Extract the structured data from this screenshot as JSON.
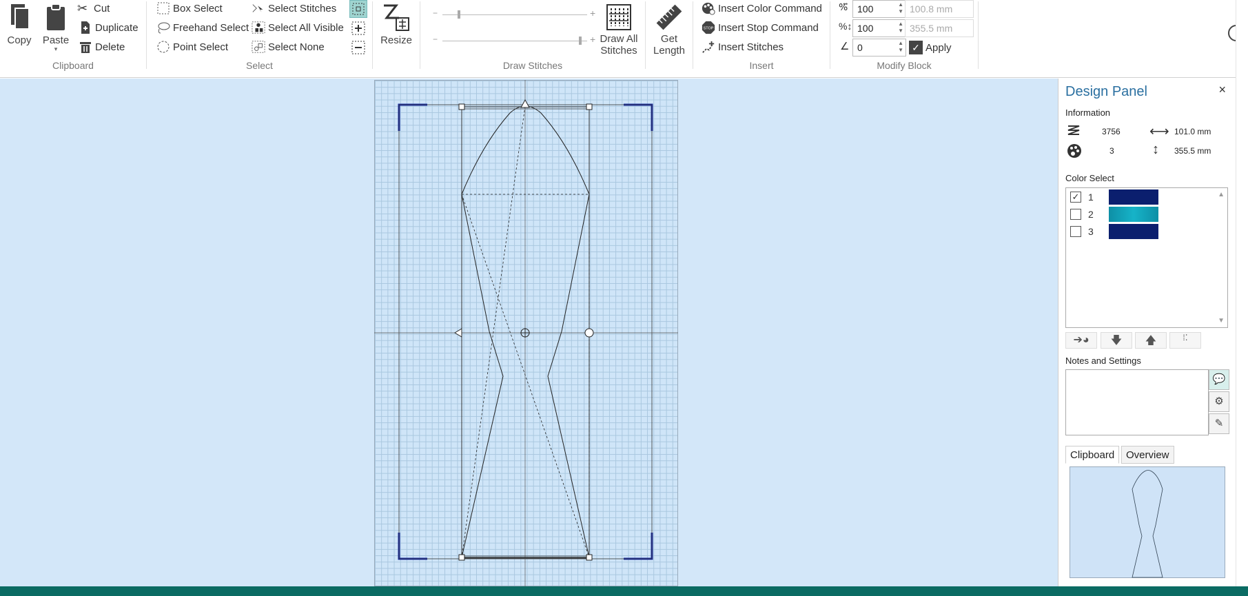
{
  "clipboard": {
    "copy": "Copy",
    "paste": "Paste",
    "cut": "Cut",
    "duplicate": "Duplicate",
    "delete": "Delete",
    "group_label": "Clipboard"
  },
  "select": {
    "box_select": "Box Select",
    "freehand_select": "Freehand Select",
    "point_select": "Point Select",
    "select_stitches": "Select Stitches",
    "select_all_visible": "Select All Visible",
    "select_none": "Select None",
    "group_label": "Select"
  },
  "resize": {
    "label": "Resize"
  },
  "draw_stitches": {
    "draw_all": "Draw All",
    "stitches": "Stitches",
    "group_label": "Draw Stitches"
  },
  "get_length": {
    "line1": "Get",
    "line2": "Length"
  },
  "insert": {
    "insert_color": "Insert Color Command",
    "insert_stop": "Insert Stop Command",
    "insert_stitches": "Insert Stitches",
    "group_label": "Insert"
  },
  "modify_block": {
    "width_pct": "100",
    "width_mm": "100.8 mm",
    "height_pct": "100",
    "height_mm": "355.5 mm",
    "rotation": "0",
    "apply": "Apply",
    "group_label": "Modify Block"
  },
  "design_panel": {
    "title": "Design Panel",
    "close": "×",
    "information": "Information",
    "stitch_count": "3756",
    "width": "101.0 mm",
    "color_count": "3",
    "height": "355.5 mm",
    "color_select": "Color Select",
    "colors": [
      {
        "num": "1",
        "checked": "✓",
        "hex": "#0b1f6e"
      },
      {
        "num": "2",
        "checked": "",
        "hex": "#109db5"
      },
      {
        "num": "3",
        "checked": "",
        "hex": "#0b1f6e"
      }
    ],
    "notes_and_settings": "Notes and Settings",
    "tabs": {
      "clipboard": "Clipboard",
      "overview": "Overview"
    }
  },
  "colors": {
    "accent": "#2a6fa0",
    "status_bar": "#0b6b63",
    "hoop_corner": "#1a2fa8"
  },
  "icons": [
    "copy-icon",
    "paste-icon",
    "cut-icon",
    "duplicate-icon",
    "delete-icon",
    "box-select-icon",
    "freehand-select-icon",
    "point-select-icon",
    "select-stitches-icon",
    "select-all-visible-icon",
    "select-none-icon",
    "resize-icon",
    "draw-all-stitches-icon",
    "ruler-icon",
    "insert-color-icon",
    "insert-stop-icon",
    "insert-stitches-icon"
  ]
}
